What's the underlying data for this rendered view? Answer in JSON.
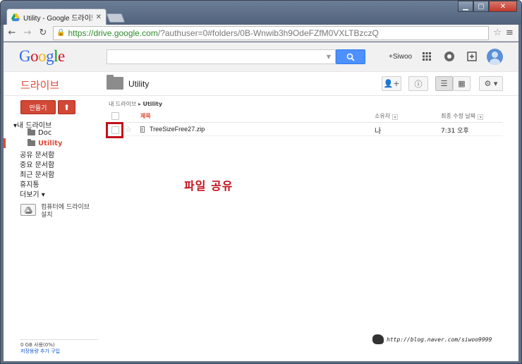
{
  "browser": {
    "tab_title": "Utility - Google 드라이브",
    "url_secure": "https://drive.google.com",
    "url_rest": "/?authuser=0#folders/0B-Wnwib3h9OdeFZfM0VXLTBzczQ"
  },
  "gbar": {
    "logo": [
      "G",
      "o",
      "o",
      "g",
      "l",
      "e"
    ],
    "user": "+Siwoo"
  },
  "drive": {
    "title": "드라이브",
    "folder_name": "Utility",
    "create_label": "만들기"
  },
  "sidebar": {
    "my_drive": "내 드라이브",
    "folders": [
      "Doc",
      "Utility"
    ],
    "items": [
      "공유 문서함",
      "중요 문서함",
      "최근 문서함",
      "휴지통",
      "더보기 ▾"
    ],
    "pc_line1": "컴퓨터에 드라이브",
    "pc_line2": "설치",
    "storage_usage": "0 GB 사용(0%)",
    "storage_link": "저장용량 추가 구입"
  },
  "breadcrumb": {
    "root": "내 드라이브",
    "current": "Utility"
  },
  "list": {
    "columns": {
      "title": "제목",
      "owner": "소유자",
      "modified": "최종 수정 날짜"
    },
    "rows": [
      {
        "name": "TreeSizeFree27.zip",
        "owner": "나",
        "modified": "7:31 오후"
      }
    ]
  },
  "annotation": "파일 공유",
  "watermark": "http://blog.naver.com/siwoo9999"
}
